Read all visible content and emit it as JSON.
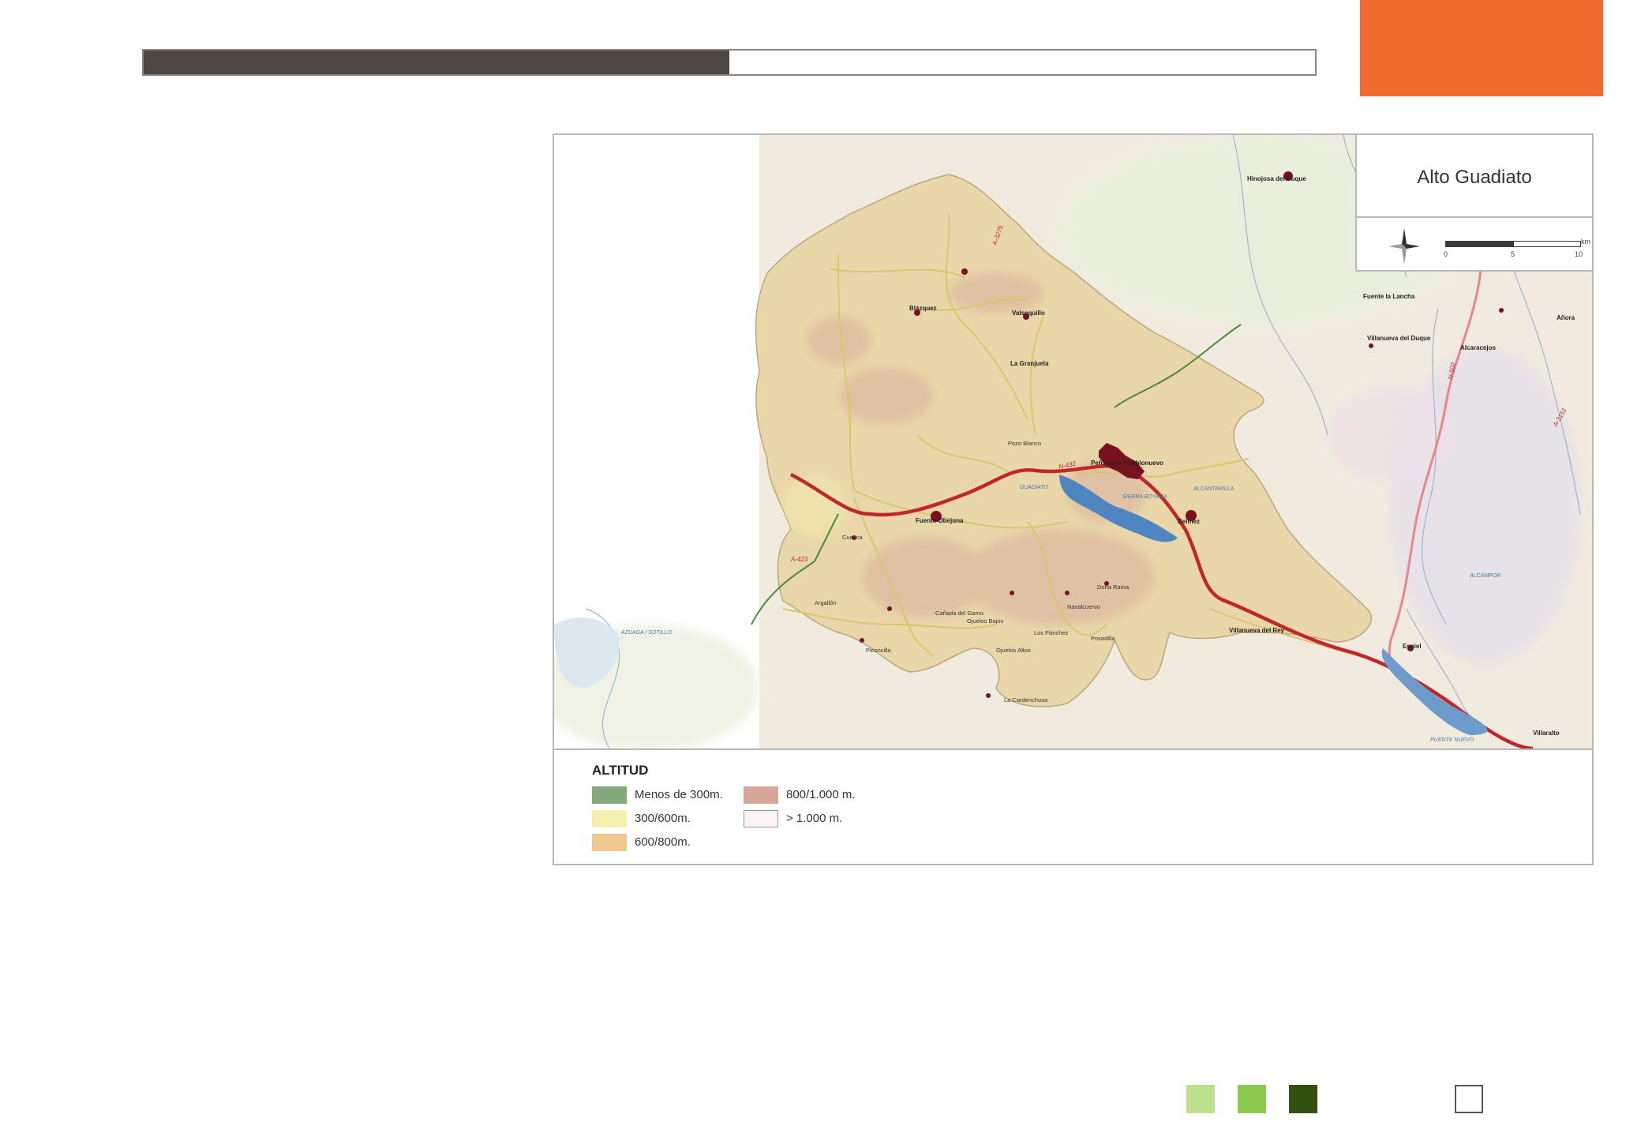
{
  "progress": {
    "fraction": 0.5
  },
  "colors": {
    "accent": "#f26b2e",
    "progress_fill": "#4f4743",
    "route": "#c0262b",
    "urban": "#7a1120",
    "water": "#4f86c2",
    "region_fill": "#e6d2a2",
    "background": "#f2ece0"
  },
  "map": {
    "title": "Alto Guadiato",
    "scale": {
      "unit": "km",
      "ticks": [
        "0",
        "5",
        "10"
      ]
    },
    "places": [
      "Hinojosa del Duque",
      "Fuente la Lancha",
      "Villanueva del Duque",
      "Alcaracejos",
      "Añora",
      "Villaralto",
      "Blázquez",
      "Valsequillo",
      "La Granjuela",
      "Peñarroya-Pueblonuevo",
      "Fuente Obejuna",
      "Belmez",
      "Villanueva del Rey",
      "Espiel",
      "Doña Rama",
      "Cuenca",
      "Cañada del Gamo",
      "Ojuelos Bajos",
      "Los Pánchez",
      "Navalcuervo",
      "Posadilla",
      "Piconcillo",
      "La Cardenchosa",
      "Ojuelos Altos",
      "Argallón",
      "Pozo Blanco"
    ],
    "roads": [
      "N-432",
      "N-502",
      "A-3275",
      "A-423",
      "A-3151"
    ],
    "water_labels": [
      "AZUAGA / SOTILLO",
      "GUADIATO",
      "SIERRA BOYERA",
      "PUENTE NUEVO",
      "ALCANTARILLA",
      "ALCAMPOR"
    ]
  },
  "legend": {
    "title": "ALTITUD",
    "items": [
      {
        "label": "Menos de 300m.",
        "color": "#85a97d"
      },
      {
        "label": "300/600m.",
        "color": "#f6efae"
      },
      {
        "label": "600/800m.",
        "color": "#f1c98f"
      },
      {
        "label": "800/1.000 m.",
        "color": "#d7a59a"
      },
      {
        "label": "> 1.000 m.",
        "color": "#fbf3f6"
      }
    ]
  },
  "footer_squares": [
    {
      "name": "light-green",
      "color": "#bde08e"
    },
    {
      "name": "green",
      "color": "#8bc94f"
    },
    {
      "name": "dark-green",
      "color": "#34500f"
    },
    {
      "name": "empty",
      "color": "#ffffff"
    }
  ]
}
